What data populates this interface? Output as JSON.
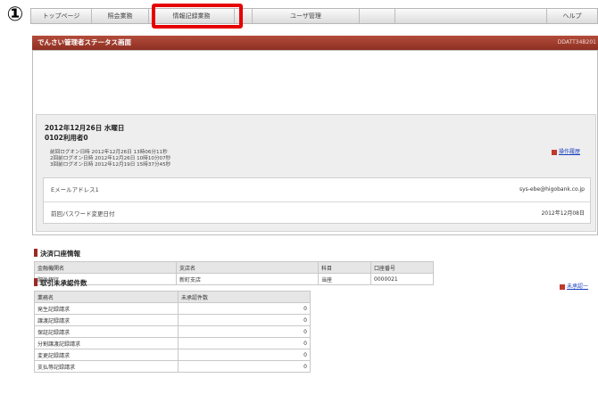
{
  "step_marker": "①",
  "nav": {
    "items": [
      "トップページ",
      "照会業務",
      "情報記録業務",
      "",
      "ユーザ管理",
      "",
      "",
      "ヘルプ"
    ]
  },
  "banner": {
    "title": "でんさい管理者ステータス画面",
    "screen_id": "DDATT34B201"
  },
  "status": {
    "date": "2012年12月26日 水曜日",
    "user": "0102利用者0",
    "logins": [
      "前回ログオン日時 2012年12月26日 13時06分11秒",
      "2回前ログオン日時 2012年12月26日 10時10分07秒",
      "3回前ログオン日時 2012年12月19日 15時37分45秒"
    ],
    "history_link": "操作履歴",
    "email_label": "Eメールアドレス1",
    "email_value": "sys-ebe@higobank.co.jp",
    "password_label": "前回パスワード変更日付",
    "password_value": "2012年12月08日"
  },
  "settlement": {
    "title": "決済口座情報",
    "headers": [
      "金融機関名",
      "支店名",
      "科目",
      "口座番号"
    ],
    "row": [
      "肥後銀行",
      "新町支店",
      "当座",
      "0000021"
    ]
  },
  "pending": {
    "title": "取引未承認件数",
    "link": "未承認一",
    "headers": [
      "業務名",
      "未承認件数"
    ],
    "rows": [
      [
        "発生記録請求",
        "0"
      ],
      [
        "譲渡記録請求",
        "0"
      ],
      [
        "保証記録請求",
        "0"
      ],
      [
        "分割譲渡記録請求",
        "0"
      ],
      [
        "変更記録請求",
        "0"
      ],
      [
        "支払等記録請求",
        "0"
      ]
    ]
  }
}
